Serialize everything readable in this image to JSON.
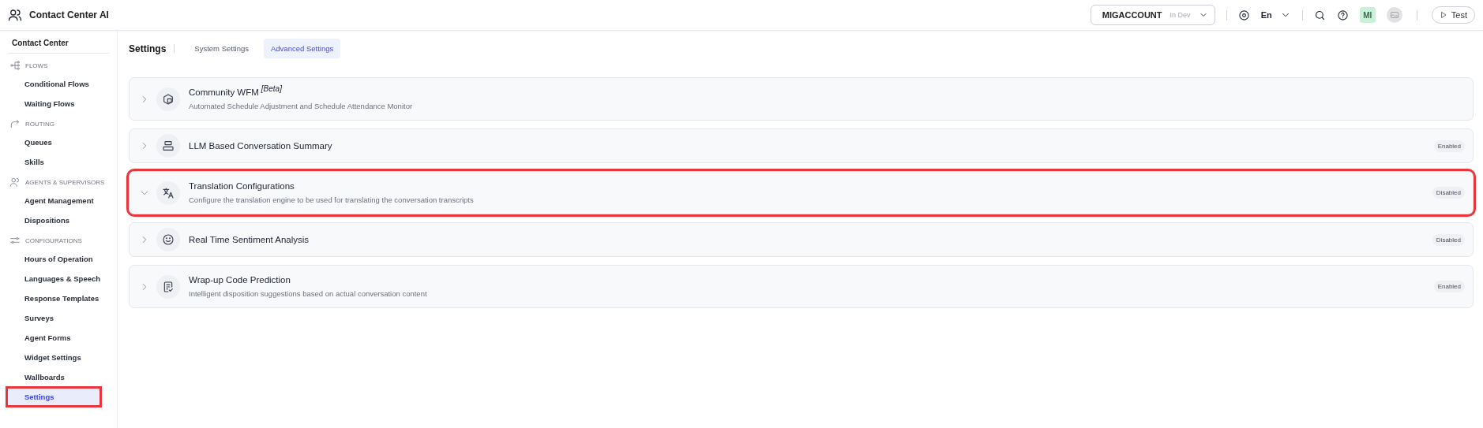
{
  "app": {
    "title": "Contact Center AI"
  },
  "header": {
    "account": "MIGACCOUNT",
    "environment": "In Dev",
    "language": "En",
    "avatar_initials": "MI",
    "test_button": "Test"
  },
  "sidebar": {
    "title": "Contact Center",
    "sections": [
      {
        "kind": "flows",
        "label": "FLOWS",
        "items": [
          {
            "label": "Conditional Flows",
            "selected": false,
            "highlighted": false
          },
          {
            "label": "Waiting Flows",
            "selected": false,
            "highlighted": false
          }
        ]
      },
      {
        "kind": "routing",
        "label": "ROUTING",
        "items": [
          {
            "label": "Queues",
            "selected": false,
            "highlighted": false
          },
          {
            "label": "Skills",
            "selected": false,
            "highlighted": false
          }
        ]
      },
      {
        "kind": "agents",
        "label": "AGENTS & SUPERVISORS",
        "items": [
          {
            "label": "Agent Management",
            "selected": false,
            "highlighted": false
          },
          {
            "label": "Dispositions",
            "selected": false,
            "highlighted": false
          }
        ]
      },
      {
        "kind": "configurations",
        "label": "CONFIGURATIONS",
        "items": [
          {
            "label": "Hours of Operation",
            "selected": false,
            "highlighted": false
          },
          {
            "label": "Languages & Speech",
            "selected": false,
            "highlighted": false
          },
          {
            "label": "Response Templates",
            "selected": false,
            "highlighted": false
          },
          {
            "label": "Surveys",
            "selected": false,
            "highlighted": false
          },
          {
            "label": "Agent Forms",
            "selected": false,
            "highlighted": false
          },
          {
            "label": "Widget Settings",
            "selected": false,
            "highlighted": false
          },
          {
            "label": "Wallboards",
            "selected": false,
            "highlighted": false
          },
          {
            "label": "Settings",
            "selected": true,
            "highlighted": true
          }
        ]
      }
    ]
  },
  "page": {
    "title": "Settings",
    "tabs": [
      {
        "label": "System Settings",
        "selected": false
      },
      {
        "label": "Advanced Settings",
        "selected": true
      }
    ]
  },
  "features": [
    {
      "kind": "community",
      "title": "Community WFM",
      "tag": "[Beta]",
      "description": "Automated Schedule Adjustment and Schedule Attendance Monitor",
      "expanded": false,
      "highlighted": false
    },
    {
      "kind": "summary",
      "title": "LLM Based Conversation Summary",
      "status": "Enabled",
      "expanded": false,
      "highlighted": false
    },
    {
      "kind": "translate",
      "title": "Translation Configurations",
      "description": "Configure the translation engine to be used for translating the conversation transcripts",
      "status": "Disabled",
      "expanded": true,
      "highlighted": true
    },
    {
      "kind": "sentiment",
      "title": "Real Time Sentiment Analysis",
      "status": "Disabled",
      "expanded": false,
      "highlighted": false
    },
    {
      "kind": "wrapup",
      "title": "Wrap-up Code Prediction",
      "description": "Intelligent disposition suggestions based on actual conversation content",
      "status": "Enabled",
      "expanded": false,
      "highlighted": false
    }
  ]
}
